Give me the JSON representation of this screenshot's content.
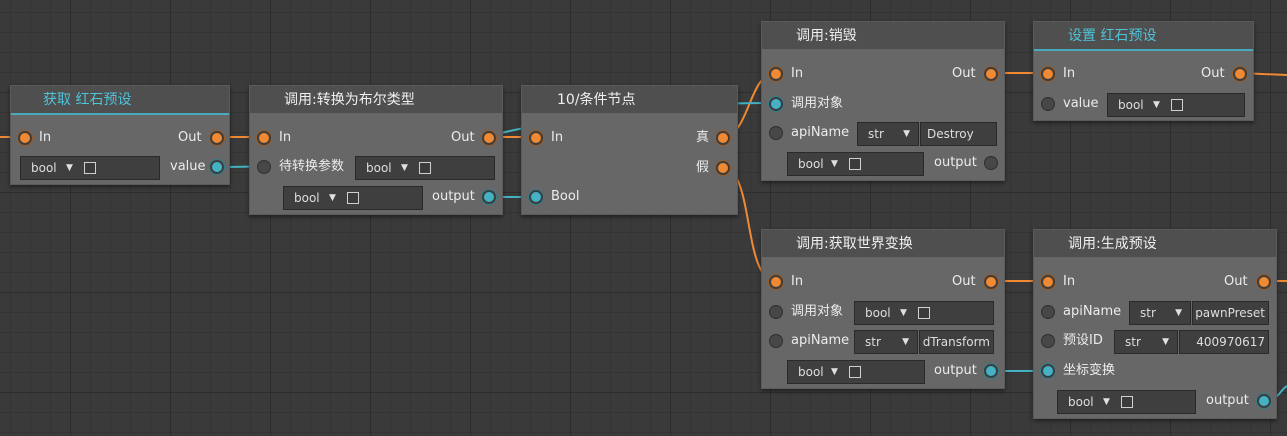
{
  "colors": {
    "canvas": "#3a3a3a",
    "node_body": "#676767",
    "node_header": "#4f4f4f",
    "exec_wire": "#ef8a33",
    "data_wire": "#45b1c4",
    "accent_title": "#4fc3d9"
  },
  "icons": {
    "exec_pin": "orange-circle-pin-icon",
    "data_pin": "teal-circle-pin-icon",
    "dropdown": "chevron-down-icon",
    "checkbox": "checkbox-icon"
  },
  "nodes": {
    "get_redstone": {
      "title": "获取 红石预设",
      "in": "In",
      "out": "Out",
      "type": "bool",
      "value_label": "value"
    },
    "cast_bool": {
      "title": "调用:转换为布尔类型",
      "in": "In",
      "out": "Out",
      "param": "待转换参数",
      "param_type": "bool",
      "out_type": "bool",
      "output": "output"
    },
    "condition": {
      "title": "10/条件节点",
      "in": "In",
      "true_label": "真",
      "false_label": "假",
      "bool_label": "Bool"
    },
    "destroy": {
      "title": "调用:销毁",
      "in": "In",
      "out": "Out",
      "target": "调用对象",
      "api_label": "apiName",
      "api_type": "str",
      "api_value": "Destroy",
      "out_type": "bool",
      "output": "output"
    },
    "set_redstone": {
      "title": "设置 红石预设",
      "in": "In",
      "out": "Out",
      "value_label": "value",
      "type": "bool"
    },
    "get_transform": {
      "title": "调用:获取世界变换",
      "in": "In",
      "out": "Out",
      "target": "调用对象",
      "target_type": "bool",
      "api_label": "apiName",
      "api_type": "str",
      "api_value": "dTransform",
      "out_type": "bool",
      "output": "output"
    },
    "spawn_preset": {
      "title": "调用:生成预设",
      "in": "In",
      "out": "Out",
      "api_label": "apiName",
      "api_type": "str",
      "api_value": "pawnPreset",
      "preset_label": "预设ID",
      "preset_type": "str",
      "preset_value": "400970617",
      "transform_label": "坐标变换",
      "out_type": "bool",
      "output": "output"
    }
  }
}
